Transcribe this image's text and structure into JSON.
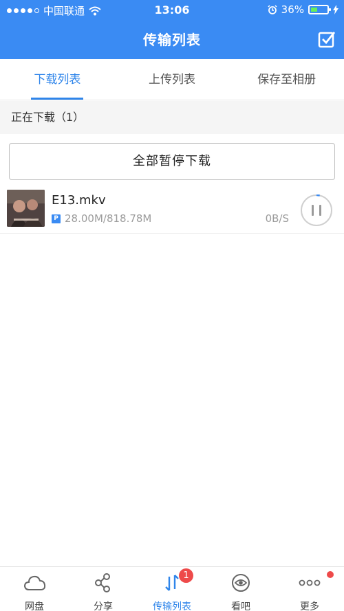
{
  "status_bar": {
    "carrier": "中国联通",
    "time": "13:06",
    "battery_percent": "36%"
  },
  "nav": {
    "title": "传输列表"
  },
  "tabs": [
    {
      "label": "下载列表",
      "active": true
    },
    {
      "label": "上传列表",
      "active": false
    },
    {
      "label": "保存至相册",
      "active": false
    }
  ],
  "section": {
    "label": "正在下载（1）"
  },
  "pause_all_label": "全部暂停下载",
  "downloads": [
    {
      "name": "E13.mkv",
      "badge": "P",
      "size": "28.00M/818.78M",
      "speed": "0B/S",
      "progress": 0.034
    }
  ],
  "bottom_nav": [
    {
      "label": "网盘",
      "icon": "cloud-icon",
      "active": false
    },
    {
      "label": "分享",
      "icon": "share-icon",
      "active": false
    },
    {
      "label": "传输列表",
      "icon": "transfer-icon",
      "active": true,
      "badge": "1"
    },
    {
      "label": "看吧",
      "icon": "eye-icon",
      "active": false
    },
    {
      "label": "更多",
      "icon": "more-icon",
      "active": false,
      "dot": true
    }
  ],
  "colors": {
    "primary": "#3a8bf3",
    "active_text": "#2f85ea",
    "badge_red": "#ee4a4a"
  }
}
